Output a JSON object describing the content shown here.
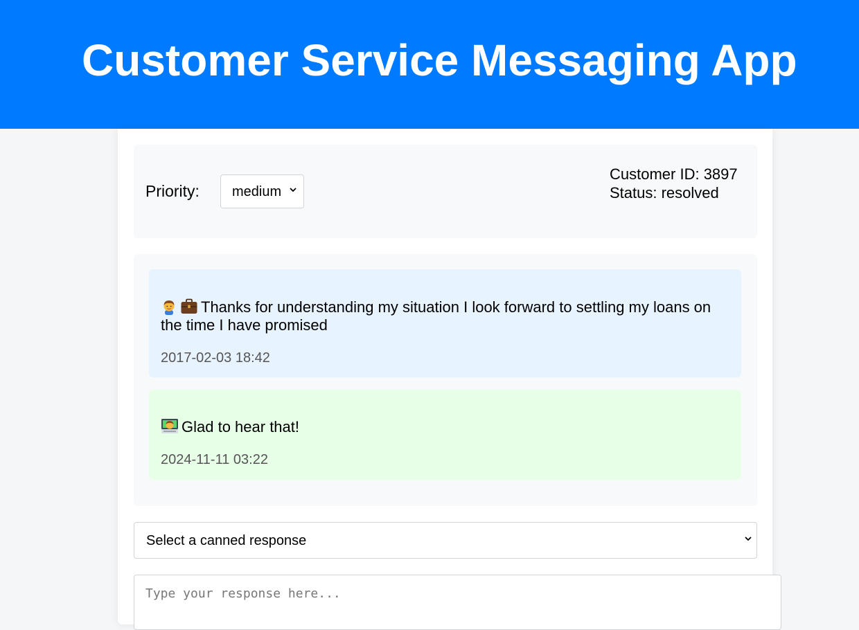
{
  "app": {
    "title": "Customer Service Messaging App",
    "accent_color": "#007bff"
  },
  "ticket": {
    "priority_label": "Priority:",
    "priority_value": "medium",
    "customer_id_text": "Customer ID: 3897",
    "status_text": "Status: resolved"
  },
  "messages": [
    {
      "sender": "customer",
      "icons": [
        "person-emoji-icon",
        "briefcase-emoji-icon"
      ],
      "text": "Thanks for understanding my situation I look forward to settling my loans on the time I have promised",
      "time": "2017-02-03 18:42",
      "bg_color": "#e7f3ff"
    },
    {
      "sender": "agent",
      "icons": [
        "technologist-emoji-icon"
      ],
      "text": "Glad to hear that!",
      "time": "2024-11-11 03:22",
      "bg_color": "#e6ffe6"
    }
  ],
  "canned": {
    "selected": "Select a canned response"
  },
  "response": {
    "placeholder": "Type your response here..."
  }
}
